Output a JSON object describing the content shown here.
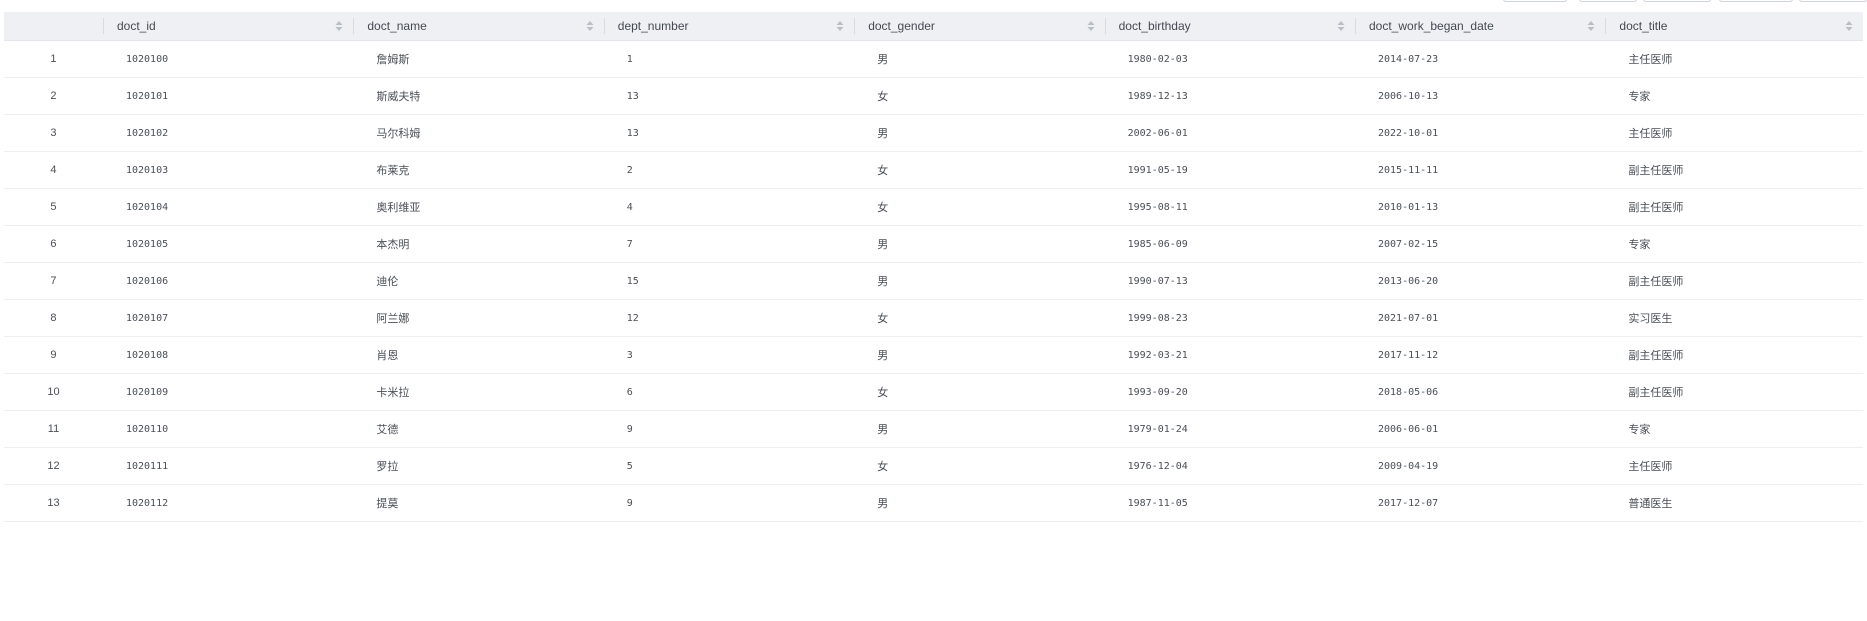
{
  "columns": [
    {
      "label": ""
    },
    {
      "label": "doct_id"
    },
    {
      "label": "doct_name"
    },
    {
      "label": "dept_number"
    },
    {
      "label": "doct_gender"
    },
    {
      "label": "doct_birthday"
    },
    {
      "label": "doct_work_began_date"
    },
    {
      "label": "doct_title"
    }
  ],
  "rows": [
    {
      "idx": "1",
      "doct_id": "1020100",
      "doct_name": "詹姆斯",
      "dept_number": "1",
      "doct_gender": "男",
      "doct_birthday": "1980-02-03",
      "doct_work_began_date": "2014-07-23",
      "doct_title": "主任医师"
    },
    {
      "idx": "2",
      "doct_id": "1020101",
      "doct_name": "斯威夫特",
      "dept_number": "13",
      "doct_gender": "女",
      "doct_birthday": "1989-12-13",
      "doct_work_began_date": "2006-10-13",
      "doct_title": "专家"
    },
    {
      "idx": "3",
      "doct_id": "1020102",
      "doct_name": "马尔科姆",
      "dept_number": "13",
      "doct_gender": "男",
      "doct_birthday": "2002-06-01",
      "doct_work_began_date": "2022-10-01",
      "doct_title": "主任医师"
    },
    {
      "idx": "4",
      "doct_id": "1020103",
      "doct_name": "布莱克",
      "dept_number": "2",
      "doct_gender": "女",
      "doct_birthday": "1991-05-19",
      "doct_work_began_date": "2015-11-11",
      "doct_title": "副主任医师"
    },
    {
      "idx": "5",
      "doct_id": "1020104",
      "doct_name": "奥利维亚",
      "dept_number": "4",
      "doct_gender": "女",
      "doct_birthday": "1995-08-11",
      "doct_work_began_date": "2010-01-13",
      "doct_title": "副主任医师"
    },
    {
      "idx": "6",
      "doct_id": "1020105",
      "doct_name": "本杰明",
      "dept_number": "7",
      "doct_gender": "男",
      "doct_birthday": "1985-06-09",
      "doct_work_began_date": "2007-02-15",
      "doct_title": "专家"
    },
    {
      "idx": "7",
      "doct_id": "1020106",
      "doct_name": "迪伦",
      "dept_number": "15",
      "doct_gender": "男",
      "doct_birthday": "1990-07-13",
      "doct_work_began_date": "2013-06-20",
      "doct_title": "副主任医师"
    },
    {
      "idx": "8",
      "doct_id": "1020107",
      "doct_name": "阿兰娜",
      "dept_number": "12",
      "doct_gender": "女",
      "doct_birthday": "1999-08-23",
      "doct_work_began_date": "2021-07-01",
      "doct_title": "实习医生"
    },
    {
      "idx": "9",
      "doct_id": "1020108",
      "doct_name": "肖恩",
      "dept_number": "3",
      "doct_gender": "男",
      "doct_birthday": "1992-03-21",
      "doct_work_began_date": "2017-11-12",
      "doct_title": "副主任医师"
    },
    {
      "idx": "10",
      "doct_id": "1020109",
      "doct_name": "卡米拉",
      "dept_number": "6",
      "doct_gender": "女",
      "doct_birthday": "1993-09-20",
      "doct_work_began_date": "2018-05-06",
      "doct_title": "副主任医师"
    },
    {
      "idx": "11",
      "doct_id": "1020110",
      "doct_name": "艾德",
      "dept_number": "9",
      "doct_gender": "男",
      "doct_birthday": "1979-01-24",
      "doct_work_began_date": "2006-06-01",
      "doct_title": "专家"
    },
    {
      "idx": "12",
      "doct_id": "1020111",
      "doct_name": "罗拉",
      "dept_number": "5",
      "doct_gender": "女",
      "doct_birthday": "1976-12-04",
      "doct_work_began_date": "2009-04-19",
      "doct_title": "主任医师"
    },
    {
      "idx": "13",
      "doct_id": "1020112",
      "doct_name": "提莫",
      "dept_number": "9",
      "doct_gender": "男",
      "doct_birthday": "1987-11-05",
      "doct_work_began_date": "2017-12-07",
      "doct_title": "普通医生"
    }
  ],
  "icons": {
    "sort": "sort-icon"
  },
  "colors": {
    "header_bg": "#eef0f3",
    "row_border": "#edeef0",
    "sort_arrow": "#b9bec6"
  }
}
